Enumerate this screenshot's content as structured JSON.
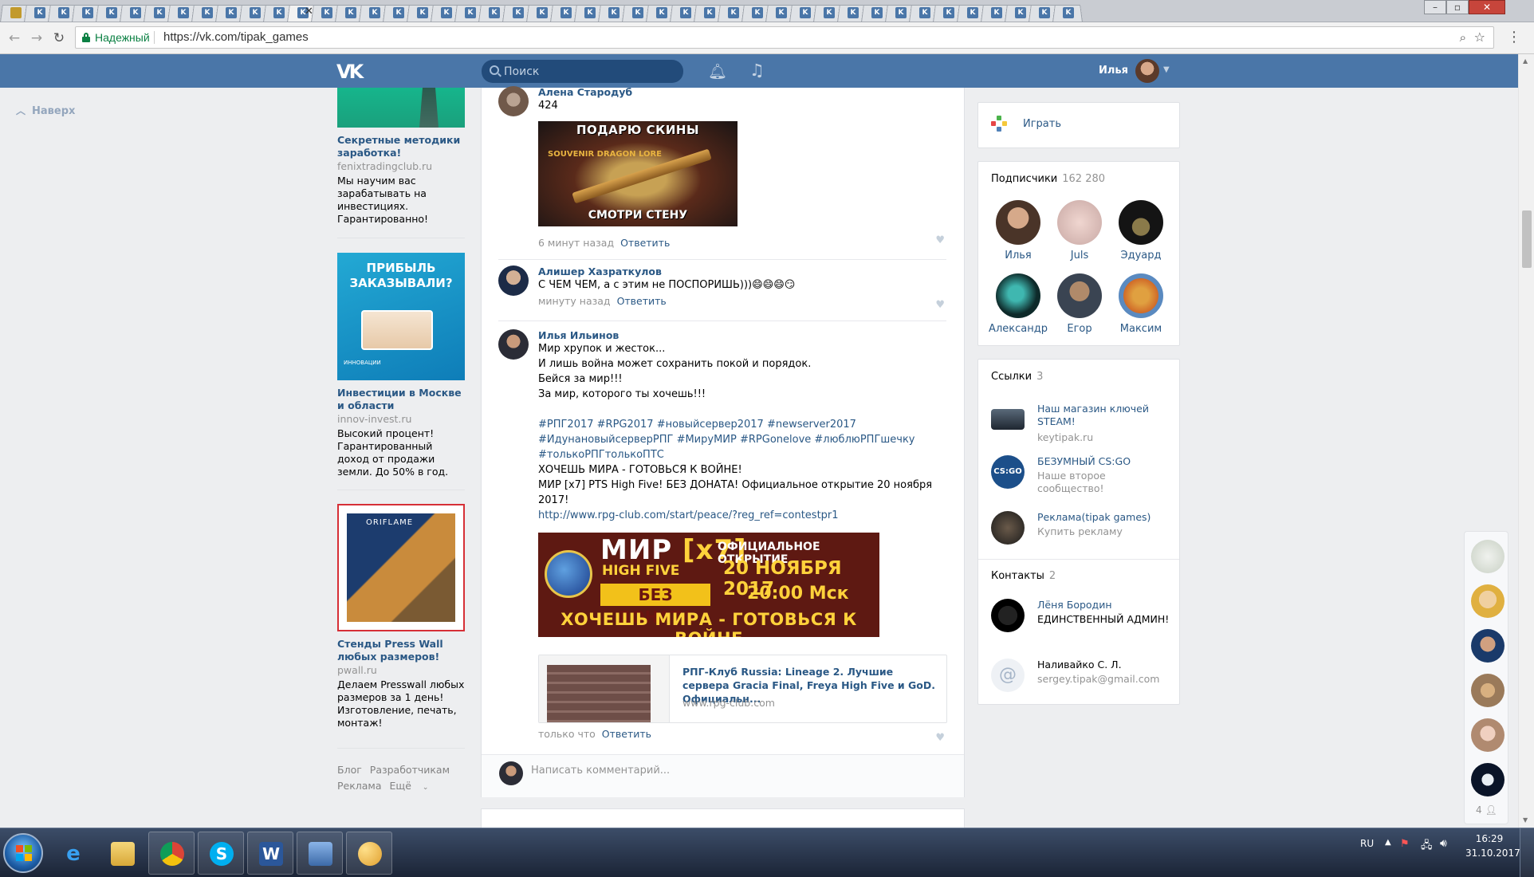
{
  "browser": {
    "tab_count": 45,
    "active_tab_index": 12,
    "tab_favicon_letter": "K",
    "active_tab_close": "✕",
    "window_controls": {
      "minimize": "–",
      "maximize": "▫",
      "close": "✕"
    },
    "security_label": "Надежный",
    "url": "https://vk.com/tipak_games"
  },
  "vk_header": {
    "logo": "VK",
    "search_placeholder": "Поиск",
    "username": "Илья"
  },
  "sidebar": {
    "scroll_top_label": "Наверх",
    "ads": [
      {
        "title": "Секретные методики заработка!",
        "domain": "fenixtradingclub.ru",
        "description": "Мы научим вас зарабатывать на инвестициях. Гарантированно!"
      },
      {
        "image_headline": "ПРИБЫЛЬ ЗАКАЗЫВАЛИ?",
        "image_brand": "ИННОВАЦИИ",
        "title": "Инвестиции в Москве и области",
        "domain": "innov-invest.ru",
        "description": "Высокий процент! Гарантированный доход от продажи земли. До 50% в год."
      },
      {
        "image_brand": "ORIFLAME",
        "title": "Стенды Press Wall любых размеров!",
        "domain": "pwall.ru",
        "description": "Делаем Presswall любых размеров за 1 день! Изготовление, печать, монтаж!"
      }
    ],
    "footer": {
      "blog": "Блог",
      "developers": "Разработчикам",
      "ads": "Реклама",
      "more": "Ещё"
    }
  },
  "comments": [
    {
      "author": "Алена Стародуб",
      "text": "424",
      "image": {
        "top_text": "ПОДАРЮ СКИНЫ",
        "logo_text": "SOUVENIR DRAGON LORE",
        "bottom_text": "СМОТРИ СТЕНУ"
      },
      "time": "6 минут назад",
      "reply": "Ответить"
    },
    {
      "author": "Алишер Хазраткулов",
      "text": "С ЧЕМ ЧЕМ, а с этим не ПОСПОРИШЬ)))😄😄😄😏",
      "time": "минуту назад",
      "reply": "Ответить"
    },
    {
      "author": "Илья Ильинов",
      "lines": [
        "Мир хрупок и жесток...",
        "И лишь война может сохранить покой и порядок.",
        "Бейся за мир!!!",
        "За мир, которого ты хочешь!!!"
      ],
      "hashtags": "#РПГ2017 #RPG2017 #новыйсервер2017 #newserver2017 #ИдунановыйсерверРПГ #МируМИР #RPGonelove #люблюРПГшечку #толькоРПГтолькоПТС",
      "after_lines": [
        "ХОЧЕШЬ МИРА - ГОТОВЬСЯ К ВОЙНЕ!",
        "МИР [x7] PTS High Five! БЕЗ ДОНАТА! Официальное открытие 20 ноября 2017!"
      ],
      "link_url": "http://www.rpg-club.com/start/peace/?reg_ref=contestpr1",
      "banner": {
        "title_a": "МИР ",
        "title_b": "[x7]",
        "high_five": "HIGH FIVE",
        "no_donate": "БЕЗ ДОНАТА",
        "official_open": "ОФИЦИАЛЬНОЕ ОТКРЫТИЕ",
        "date": "20 НОЯБРЯ 2017",
        "time": "20:00 Мск",
        "slogan": "ХОЧЕШЬ МИРА - ГОТОВЬСЯ К ВОЙНЕ"
      },
      "link_card": {
        "title": "РПГ-Клуб Russia: Lineage 2. Лучшие сервера Gracia Final, Freya High Five и GoD. Официальн...",
        "domain": "www.rpg-club.com"
      },
      "time": "только что",
      "reply": "Ответить"
    }
  ],
  "write_comment": {
    "placeholder": "Написать комментарий..."
  },
  "right": {
    "games_label": "Играть",
    "subscribers": {
      "title": "Подписчики",
      "count": "162 280",
      "people": [
        "Илья",
        "Juls",
        "Эдуард",
        "Александр",
        "Егор",
        "Максим"
      ]
    },
    "links": {
      "title": "Ссылки",
      "count": "3",
      "items": [
        {
          "title": "Наш магазин ключей STEAM!",
          "sub": "keytipak.ru"
        },
        {
          "title": "БЕЗУМНЫЙ CS:GO",
          "sub": "Наше второе сообщество!",
          "avatar_text": "CS:GO"
        },
        {
          "title": "Реклама(tipak games)",
          "sub": "Купить рекламу"
        }
      ]
    },
    "contacts": {
      "title": "Контакты",
      "count": "2",
      "items": [
        {
          "name": "Лёня Бородин",
          "sub": "ЕДИНСТВЕННЫЙ АДМИН!"
        },
        {
          "name": "Наливайко С. Л.",
          "sub": "sergey.tipak@gmail.com"
        }
      ]
    }
  },
  "chatbar": {
    "count": "4"
  },
  "taskbar": {
    "lang": "RU",
    "time": "16:29",
    "date": "31.10.2017"
  },
  "colors": {
    "vk_blue": "#4a76a8",
    "link": "#2a5885",
    "secure_green": "#0b8043"
  }
}
